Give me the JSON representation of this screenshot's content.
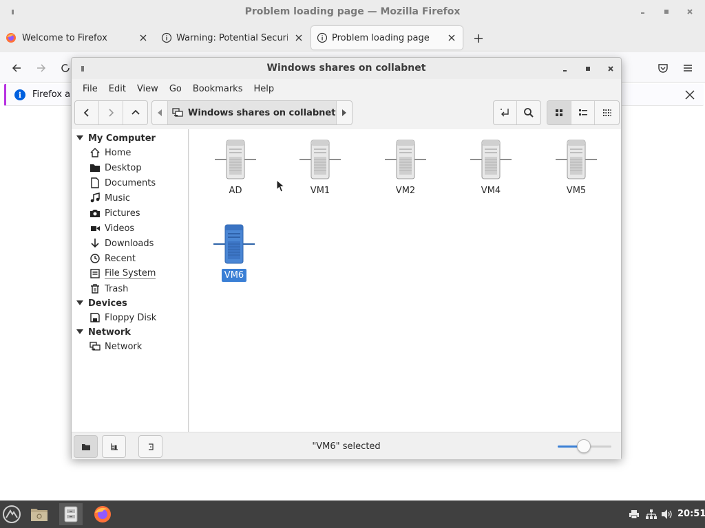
{
  "firefox": {
    "title": "Problem loading page — Mozilla Firefox",
    "tabs": [
      {
        "label": "Welcome to Firefox",
        "icon": "firefox-logo-icon"
      },
      {
        "label": "Warning: Potential Security",
        "icon": "info-icon"
      },
      {
        "label": "Problem loading page",
        "icon": "info-icon"
      }
    ],
    "notification": {
      "text": "Firefox au"
    }
  },
  "file_manager": {
    "title": "Windows shares on collabnet",
    "menu": [
      "File",
      "Edit",
      "View",
      "Go",
      "Bookmarks",
      "Help"
    ],
    "path": "Windows shares on collabnet",
    "sidebar": {
      "sections": [
        {
          "heading": "My Computer",
          "items": [
            {
              "label": "Home",
              "icon": "home-icon"
            },
            {
              "label": "Desktop",
              "icon": "folder-icon"
            },
            {
              "label": "Documents",
              "icon": "document-icon"
            },
            {
              "label": "Music",
              "icon": "music-icon"
            },
            {
              "label": "Pictures",
              "icon": "camera-icon"
            },
            {
              "label": "Videos",
              "icon": "video-icon"
            },
            {
              "label": "Downloads",
              "icon": "download-icon"
            },
            {
              "label": "Recent",
              "icon": "clock-icon"
            },
            {
              "label": "File System",
              "icon": "drive-icon"
            },
            {
              "label": "Trash",
              "icon": "trash-icon"
            }
          ]
        },
        {
          "heading": "Devices",
          "items": [
            {
              "label": "Floppy Disk",
              "icon": "floppy-icon"
            }
          ]
        },
        {
          "heading": "Network",
          "items": [
            {
              "label": "Network",
              "icon": "network-icon"
            }
          ]
        }
      ]
    },
    "items": [
      {
        "label": "AD",
        "selected": false
      },
      {
        "label": "VM1",
        "selected": false
      },
      {
        "label": "VM2",
        "selected": false
      },
      {
        "label": "VM4",
        "selected": false
      },
      {
        "label": "VM5",
        "selected": false
      },
      {
        "label": "VM6",
        "selected": true
      }
    ],
    "status": "\"VM6\" selected",
    "zoom_level": 0.48,
    "selection_color": "#3a7fd5"
  },
  "taskbar": {
    "clock": "20:51"
  }
}
